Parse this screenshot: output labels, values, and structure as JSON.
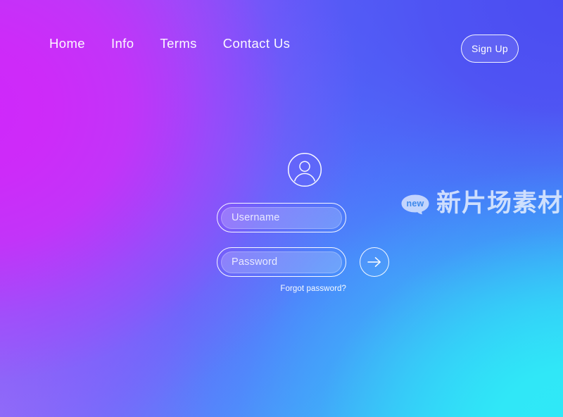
{
  "page": {
    "title": "Login Page",
    "background": {
      "type": "diagonal-gradient",
      "colors": {
        "top_left": "#c42ef5",
        "left_middle": "#ca2cf8",
        "top_right": "#4f4ff0",
        "center": "#6e4ef9",
        "right_middle": "#4484fb",
        "bottom_left": "#9a74f7",
        "bottom_center": "#6699fb",
        "bottom_right": "#36e3f5"
      }
    }
  },
  "nav": {
    "links": [
      {
        "label": "Home",
        "name": "nav-link-home"
      },
      {
        "label": "Info",
        "name": "nav-link-info"
      },
      {
        "label": "Terms",
        "name": "nav-link-terms"
      },
      {
        "label": "Contact Us",
        "name": "nav-link-contact-us"
      }
    ],
    "signup": {
      "label": "Sign Up"
    }
  },
  "form": {
    "avatar_icon": "user-avatar-icon",
    "username": {
      "placeholder": "Username",
      "value": ""
    },
    "password": {
      "placeholder": "Password",
      "value": ""
    },
    "submit_icon": "arrow-right-icon",
    "forgot_password": {
      "label": "Forgot password?"
    }
  },
  "watermark": {
    "badge_label": "new",
    "text": "新片场素材",
    "badge_color": "#3d8ce8"
  }
}
